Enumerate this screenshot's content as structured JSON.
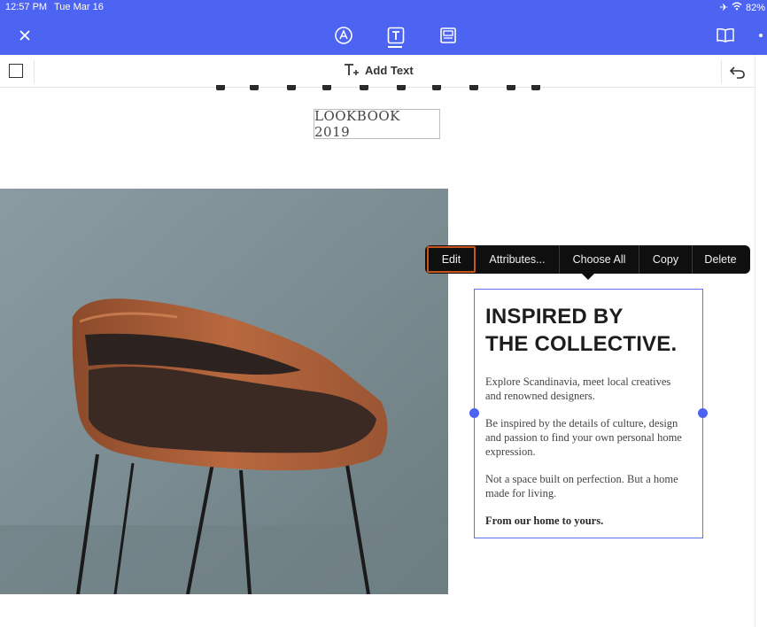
{
  "status_bar": {
    "time": "12:57 PM",
    "date": "Tue Mar 16",
    "battery": "82%"
  },
  "top_toolbar": {
    "icons": [
      "close-icon",
      "draw-icon",
      "text-icon",
      "image-icon",
      "book-icon"
    ]
  },
  "toolbar": {
    "add_text_label": "Add Text"
  },
  "page": {
    "lookbook_label": "LOOKBOOK 2019"
  },
  "context_menu": {
    "items": [
      "Edit",
      "Attributes...",
      "Choose All",
      "Copy",
      "Delete"
    ]
  },
  "text_block": {
    "heading_line1": "INSPIRED BY",
    "heading_line2": "THE COLLECTIVE.",
    "paragraph1": "Explore Scandinavia, meet local creatives and renowned designers.",
    "paragraph2": "Be inspired by the details of culture, design and passion to find your own personal home expression.",
    "paragraph3": "Not a space built on perfection. But a home made for living.",
    "paragraph4": "From our home to yours."
  },
  "colors": {
    "accent": "#4d63f1",
    "menu_bg": "#0f0f0f",
    "edit_highlight": "#c8541c"
  }
}
